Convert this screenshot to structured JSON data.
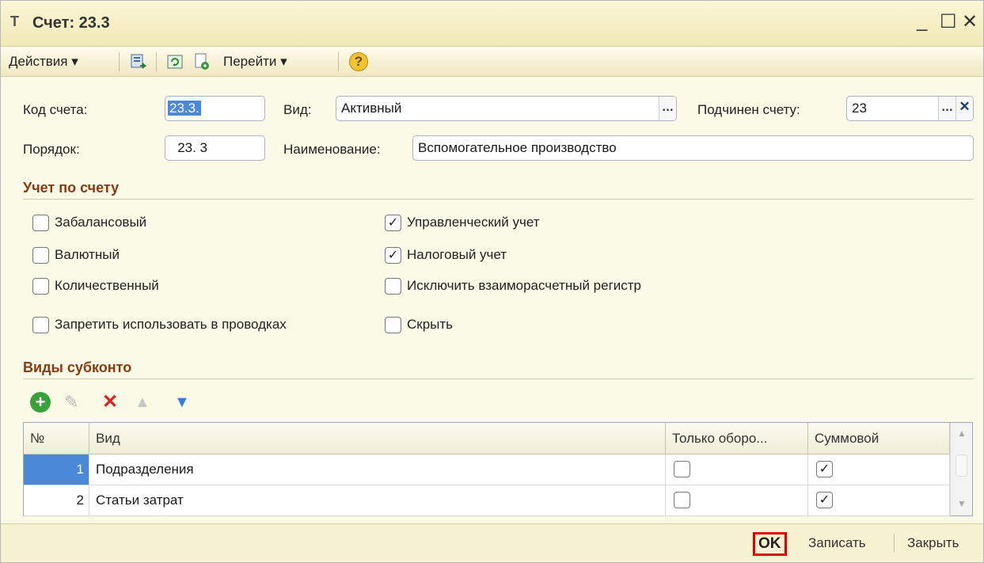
{
  "window": {
    "title": "Счет: 23.3",
    "app_icon": "Т"
  },
  "window_controls": {
    "minimize": "_",
    "maximize": "☐",
    "close": "✕"
  },
  "toolbar": {
    "actions": "Действия ▾",
    "goto": "Перейти ▾",
    "help": "?"
  },
  "form": {
    "code_label": "Код счета:",
    "code_value": "23.3.",
    "kind_label": "Вид:",
    "kind_value": "Активный",
    "parent_label": "Подчинен счету:",
    "parent_value": "23",
    "order_label": "Порядок:",
    "order_value": "23. 3",
    "name_label": "Наименование:",
    "name_value": "Вспомогательное производство",
    "dots": "...",
    "clear": "✕"
  },
  "accounting": {
    "title": "Учет по счету",
    "checks": [
      {
        "label": "Забалансовый",
        "checked": false,
        "mark": ""
      },
      {
        "label": "Валютный",
        "checked": false,
        "mark": ""
      },
      {
        "label": "Количественный",
        "checked": false,
        "mark": ""
      },
      {
        "label": "Запретить использовать в проводках",
        "checked": false,
        "mark": ""
      },
      {
        "label": "Управленческий учет",
        "checked": true,
        "mark": "✓"
      },
      {
        "label": "Налоговый учет",
        "checked": true,
        "mark": "✓"
      },
      {
        "label": "Исключить взаиморасчетный регистр",
        "checked": false,
        "mark": ""
      },
      {
        "label": "Скрыть",
        "checked": false,
        "mark": ""
      }
    ]
  },
  "subconto": {
    "title": "Виды субконто",
    "tools": {
      "add": "+",
      "edit": "✎",
      "delete": "✕",
      "up": "▲",
      "down": "▼"
    },
    "columns": [
      "№",
      "Вид",
      "Только оборо...",
      "Суммовой"
    ],
    "rows": [
      {
        "n": "1",
        "kind": "Подразделения",
        "turnover": "",
        "sum": "✓"
      },
      {
        "n": "2",
        "kind": "Статьи затрат",
        "turnover": "",
        "sum": "✓"
      }
    ],
    "scroll_up": "▲",
    "scroll_down": "▼"
  },
  "footer": {
    "ok": "OK",
    "save": "Записать",
    "close": "Закрыть"
  },
  "colors": {
    "ok_highlight": "#e30000",
    "section": "#8a3a10",
    "selected_row": "#4a88d8"
  }
}
